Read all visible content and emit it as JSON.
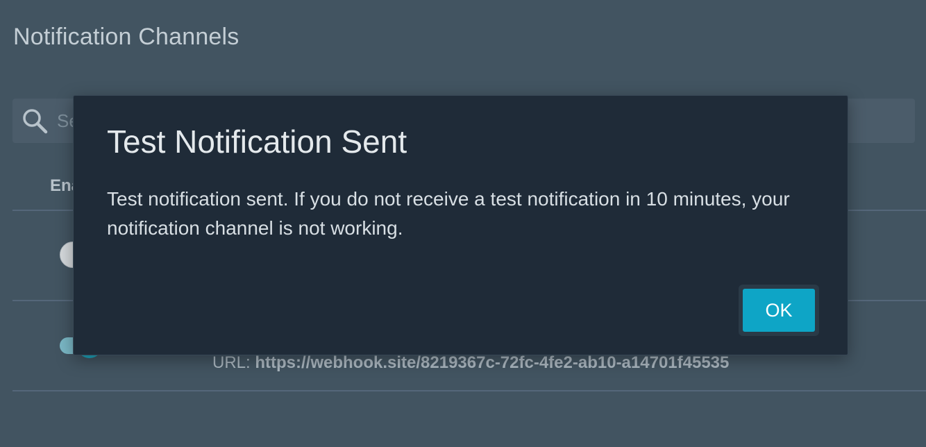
{
  "page": {
    "title": "Notification Channels"
  },
  "search": {
    "placeholder": "Search",
    "icon": "search-icon"
  },
  "table": {
    "enabled_header": "Enabled",
    "rows": [
      {
        "enabled": false
      },
      {
        "enabled": true,
        "url_label": "URL:",
        "url_value": "https://webhook.site/8219367c-72fc-4fe2-ab10-a14701f45535"
      }
    ]
  },
  "modal": {
    "title": "Test Notification Sent",
    "message": "Test notification sent. If you do not receive a test notification in 10 minutes, your notification channel is not working.",
    "ok_label": "OK"
  },
  "colors": {
    "background": "#425461",
    "modal_background": "#1f2b38",
    "accent": "#0ea5c6"
  }
}
